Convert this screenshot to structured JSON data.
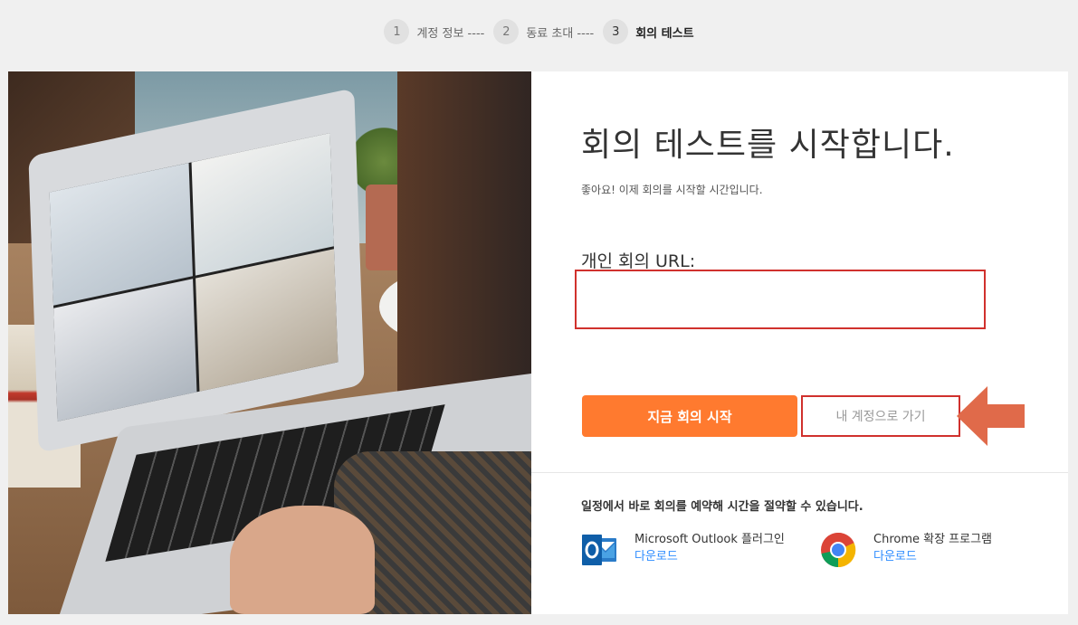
{
  "stepper": {
    "steps": [
      {
        "num": "1",
        "label": "계정 정보 ----"
      },
      {
        "num": "2",
        "label": "동료 초대 ----"
      },
      {
        "num": "3",
        "label": "회의 테스트"
      }
    ]
  },
  "main": {
    "title": "회의 테스트를 시작합니다.",
    "subtitle": "좋아요! 이제 회의를 시작할 시간입니다.",
    "url_label": "개인 회의 URL:",
    "url_value": "",
    "start_button": "지금 회의 시작",
    "account_button": "내 계정으로 가기",
    "schedule_text": "일정에서 바로 회의를 예약해 시간을 절약할 수 있습니다.",
    "plugins": [
      {
        "name": "Microsoft Outlook 플러그인",
        "link": "다운로드",
        "icon": "outlook-icon"
      },
      {
        "name": "Chrome 확장 프로그램",
        "link": "다운로드",
        "icon": "chrome-icon"
      }
    ]
  },
  "colors": {
    "accent": "#ff7a2f",
    "annotation_red": "#d0312d",
    "arrow": "#e06a4a",
    "link": "#2d8cff"
  }
}
